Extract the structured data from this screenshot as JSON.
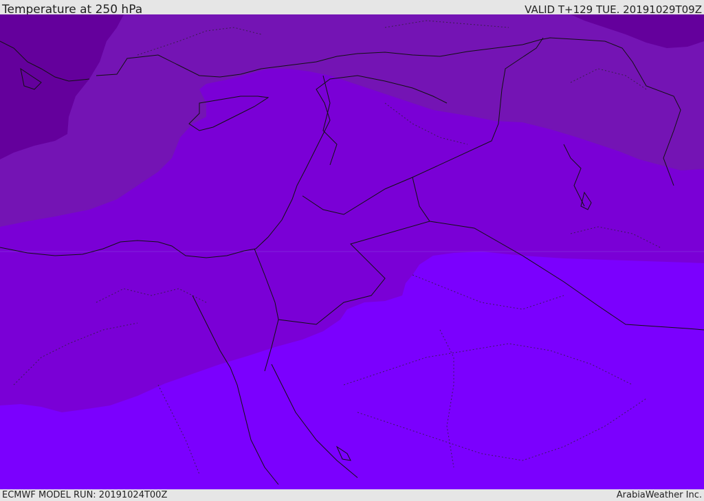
{
  "header": {
    "title": "Temperature at 250 hPa",
    "valid": "VALID T+129 TUE. 20191029T09Z"
  },
  "footer": {
    "model_run": "ECMWF MODEL RUN: 20191024T00Z",
    "credit": "ArabiaWeather Inc."
  },
  "colors": {
    "band_darkest": "#64009c",
    "band_dark": "#7414b4",
    "band_mid": "#7a00d6",
    "band_light": "#7b00fe",
    "borders": "#111111"
  }
}
